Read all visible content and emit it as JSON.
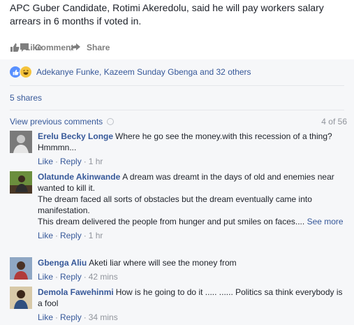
{
  "post": {
    "text": "APC Guber Candidate, Rotimi Akeredolu, said he will pay workers salary arrears in 6 months if voted in."
  },
  "actions": {
    "like": "Like",
    "comment": "Comment",
    "share": "Share"
  },
  "reactions": {
    "text": "Adekanye Funke, Kazeem Sunday Gbenga and 32 others",
    "icons": [
      "like-reaction-icon",
      "haha-reaction-icon"
    ]
  },
  "shares": "5 shares",
  "comments_header": {
    "view_previous": "View previous comments",
    "count": "4 of 56"
  },
  "comments": [
    {
      "author": "Erelu Becky Longe",
      "paragraphs": [
        "Where he go see the money.with this recession of a thing? Hmmmn..."
      ],
      "like": "Like",
      "reply": "Reply",
      "time": "1 hr"
    },
    {
      "author": "Olatunde Akinwande",
      "paragraphs": [
        "A dream was dreamt in the days of old and enemies near wanted to kill it.",
        "The dream faced all sorts of obstacles but the dream eventually came into manifestation.",
        "This dream delivered the people from hunger and put smiles on faces...."
      ],
      "see_more": "See more",
      "like": "Like",
      "reply": "Reply",
      "time": "1 hr"
    },
    {
      "author": "Gbenga Aliu",
      "paragraphs": [
        "Aketi liar where will see the money from"
      ],
      "like": "Like",
      "reply": "Reply",
      "time": "42 mins"
    },
    {
      "author": "Demola Fawehinmi",
      "paragraphs": [
        "How is he going to do it ..... ...... Politics sa think everybody is a fool"
      ],
      "like": "Like",
      "reply": "Reply",
      "time": "34 mins"
    }
  ],
  "colors": {
    "link": "#365899",
    "muted": "#90949c",
    "action": "#7f7f7f",
    "comments_bg": "#f6f7f9"
  }
}
